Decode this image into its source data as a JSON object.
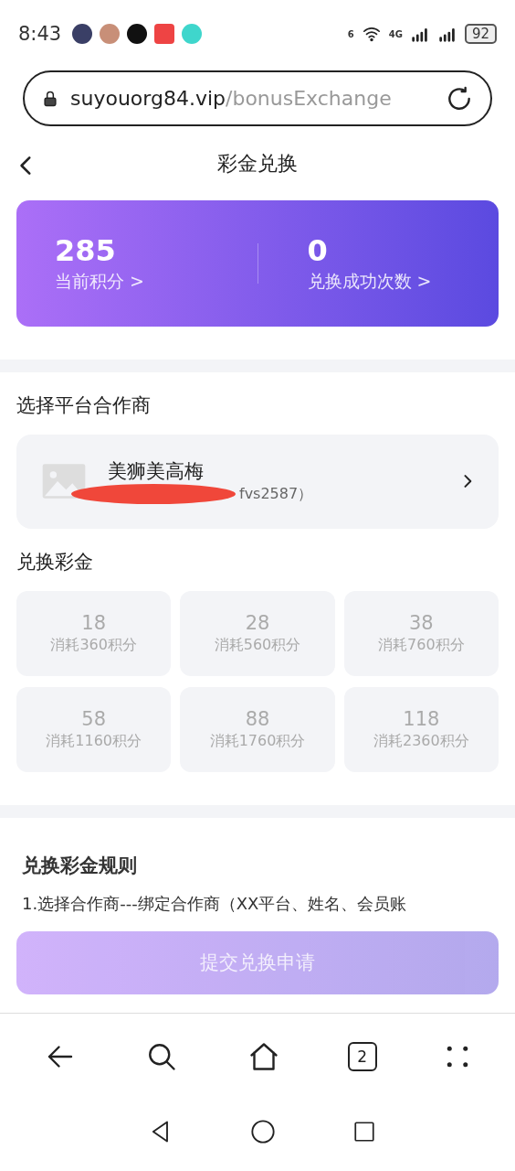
{
  "status_bar": {
    "time": "8:43",
    "wifi_label": "6",
    "network_label": "4G",
    "battery": "92"
  },
  "address_bar": {
    "domain": "suyouorg84.vip",
    "path": "/bonusExchange"
  },
  "header": {
    "title": "彩金兑换"
  },
  "stats": [
    {
      "value": "285",
      "label": "当前积分 >"
    },
    {
      "value": "0",
      "label": "兑换成功次数 >"
    }
  ],
  "partner_section": {
    "title": "选择平台合作商",
    "partner": {
      "name": "美狮美高梅",
      "subtitle": "fvs2587）"
    }
  },
  "bonus_section": {
    "title": "兑换彩金",
    "options": [
      {
        "amount": "18",
        "cost": "消耗360积分"
      },
      {
        "amount": "28",
        "cost": "消耗560积分"
      },
      {
        "amount": "38",
        "cost": "消耗760积分"
      },
      {
        "amount": "58",
        "cost": "消耗1160积分"
      },
      {
        "amount": "88",
        "cost": "消耗1760积分"
      },
      {
        "amount": "118",
        "cost": "消耗2360积分"
      }
    ]
  },
  "rules": {
    "title": "兑换彩金规则",
    "text": "1.选择合作商---绑定合作商（XX平台、姓名、会员账"
  },
  "submit": {
    "label": "提交兑换申请",
    "disabled": true
  },
  "browser_nav": {
    "tab_count": "2"
  }
}
